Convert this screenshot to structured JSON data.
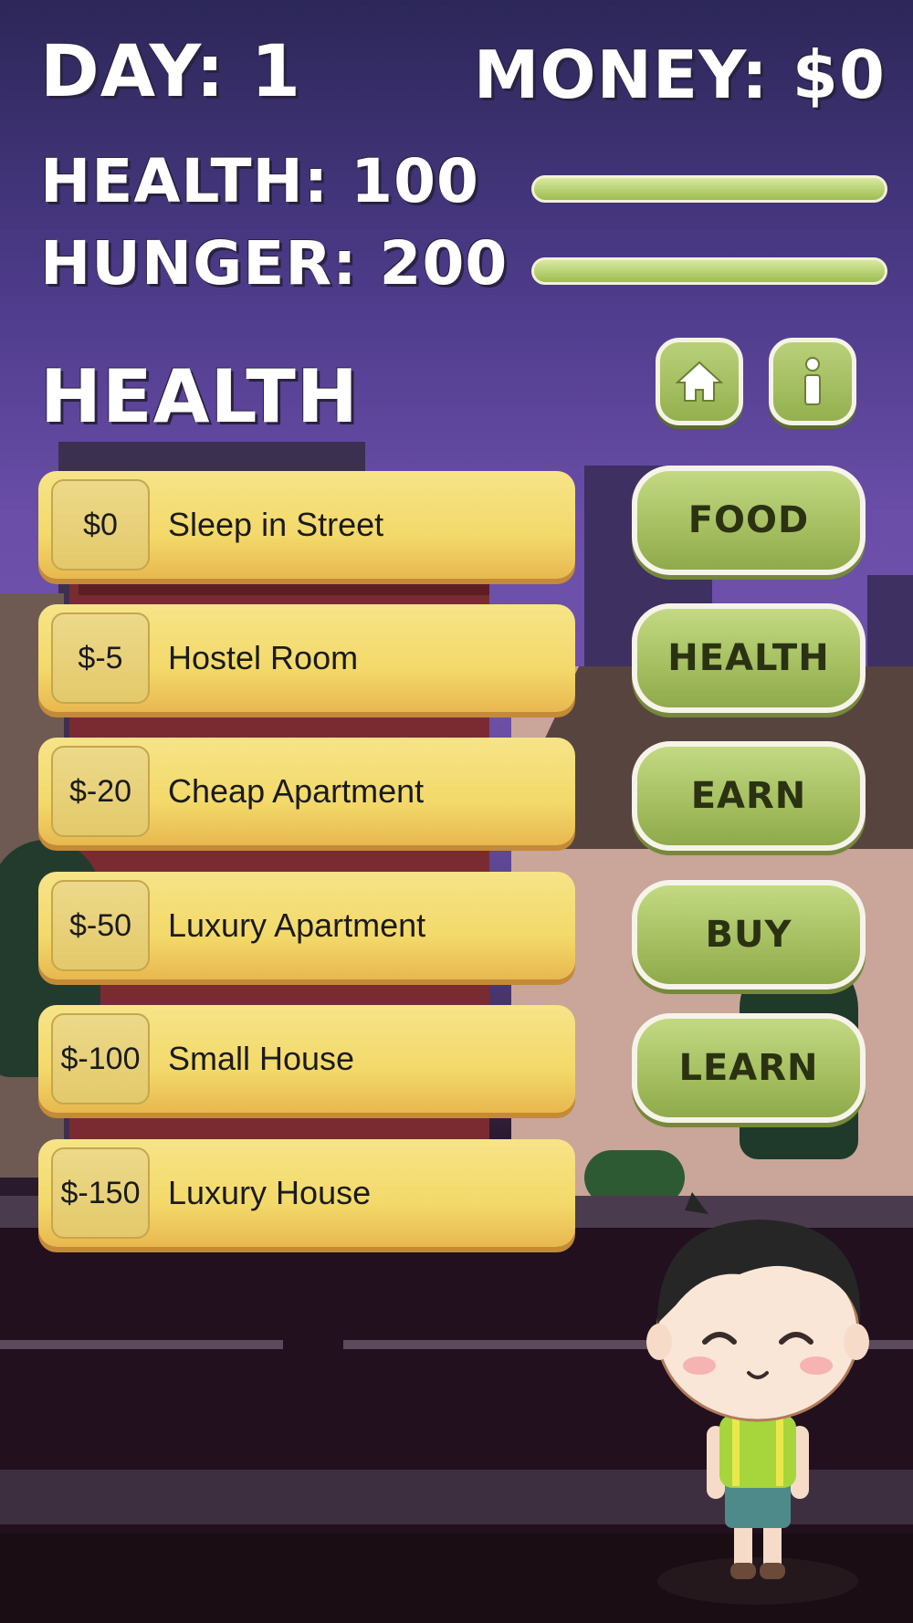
{
  "hud": {
    "day": "DAY: 1",
    "money": "MONEY: $0",
    "health": "HEALTH: 100",
    "hunger": "HUNGER: 200",
    "health_bar_level": 1.0,
    "hunger_bar_level": 1.0
  },
  "section_title": "HEALTH",
  "icons": {
    "home": "home-icon",
    "info": "info-icon"
  },
  "options": [
    {
      "price": "$0",
      "label": "Sleep in Street"
    },
    {
      "price": "$-5",
      "label": "Hostel Room"
    },
    {
      "price": "$-20",
      "label": "Cheap Apartment"
    },
    {
      "price": "$-50",
      "label": "Luxury Apartment"
    },
    {
      "price": "$-100",
      "label": "Small House"
    },
    {
      "price": "$-150",
      "label": "Luxury House"
    }
  ],
  "menu": [
    {
      "label": "FOOD"
    },
    {
      "label": "HEALTH"
    },
    {
      "label": "EARN"
    },
    {
      "label": "BUY"
    },
    {
      "label": "LEARN"
    }
  ],
  "colors": {
    "accent_green": "#a6c062",
    "option_yellow": "#f3d96a",
    "sky_purple": "#6a4ea8"
  }
}
